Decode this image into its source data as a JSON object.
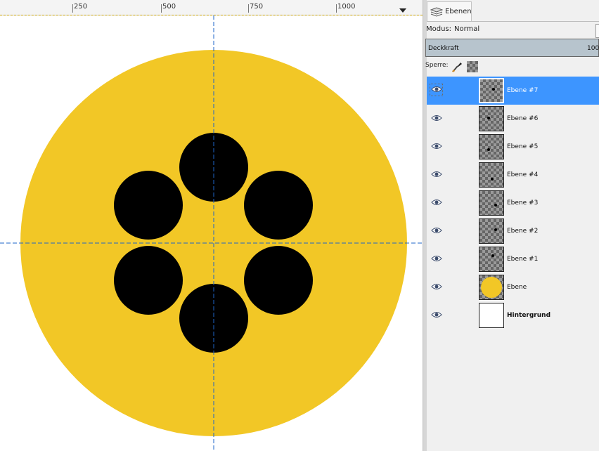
{
  "ruler": {
    "labels": [
      "250",
      "500",
      "750",
      "1000"
    ]
  },
  "dock": {
    "tab_label": "Ebenen",
    "mode_label": "Modus:",
    "mode_value": "Normal",
    "opacity_label": "Deckkraft",
    "opacity_value": "100,",
    "lock_label": "Sperre:"
  },
  "layers": [
    {
      "name": "Ebene #7",
      "selected": true
    },
    {
      "name": "Ebene #6"
    },
    {
      "name": "Ebene #5"
    },
    {
      "name": "Ebene #4"
    },
    {
      "name": "Ebene #3"
    },
    {
      "name": "Ebene #2"
    },
    {
      "name": "Ebene #1"
    },
    {
      "name": "Ebene"
    },
    {
      "name": "Hintergrund"
    }
  ],
  "colors": {
    "yellow_circle": "#f2c726",
    "black_dots": "#000000",
    "guide": "#1e64c8",
    "selection_highlight": "#3d95ff"
  }
}
